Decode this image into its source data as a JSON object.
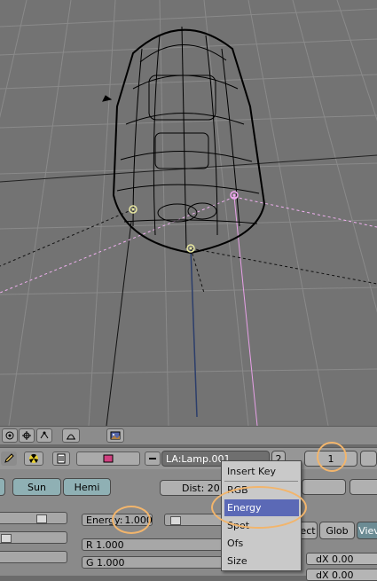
{
  "viewport": {
    "grid_color": "#8a8a8a",
    "bg_color": "#737373"
  },
  "header_icons": [
    "orbit-icon",
    "transform-icon",
    "snap-icon",
    "proportional-icon",
    "image-icon"
  ],
  "button_header": {
    "lamp_name": "LA:Lamp.001",
    "user_count": "2",
    "frame_value": "1"
  },
  "lamp_types": {
    "sun": "Sun",
    "hemi": "Hemi"
  },
  "lamp_settings": {
    "dist_label": "Dist: 20",
    "energy_label": "Energy:",
    "energy_value": "1.000",
    "r_label": "R 1.000",
    "g_label": "G 1.000"
  },
  "transform_buttons": {
    "ect": "ect",
    "glob": "Glob",
    "view": "Viev"
  },
  "offsets": {
    "dx1": "dX 0.00",
    "dx2": "dX 0.00"
  },
  "insert_key_menu": {
    "title": "Insert Key",
    "items": [
      "RGB",
      "Energy",
      "Spot",
      "Ofs",
      "Size"
    ],
    "selected": "Energy",
    "selected_color": "#5b69b6"
  },
  "annotation_color": "#f2b56c"
}
